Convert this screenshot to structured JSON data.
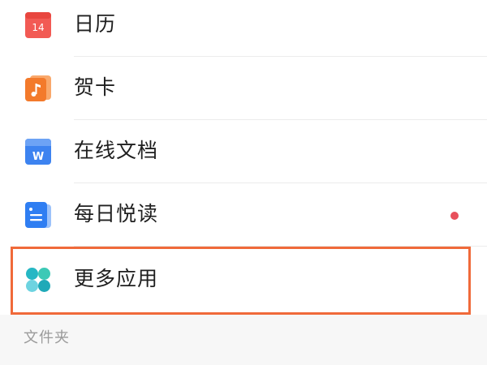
{
  "menu": {
    "items": [
      {
        "label": "日历",
        "icon": "calendar-icon",
        "icon_text": "14",
        "color": "#f25a54"
      },
      {
        "label": "贺卡",
        "icon": "greeting-card-icon",
        "color": "#f37a2b"
      },
      {
        "label": "在线文档",
        "icon": "online-doc-icon",
        "icon_text": "W",
        "color": "#3d83f0"
      },
      {
        "label": "每日悦读",
        "icon": "daily-reading-icon",
        "color": "#2f7ef2",
        "has_badge": true,
        "badge_color": "#e8505b"
      },
      {
        "label": "更多应用",
        "icon": "more-apps-icon",
        "color": "#2dbfbf",
        "highlighted": true
      }
    ]
  },
  "section": {
    "title": "文件夹"
  },
  "highlight_color": "#f06a3a"
}
